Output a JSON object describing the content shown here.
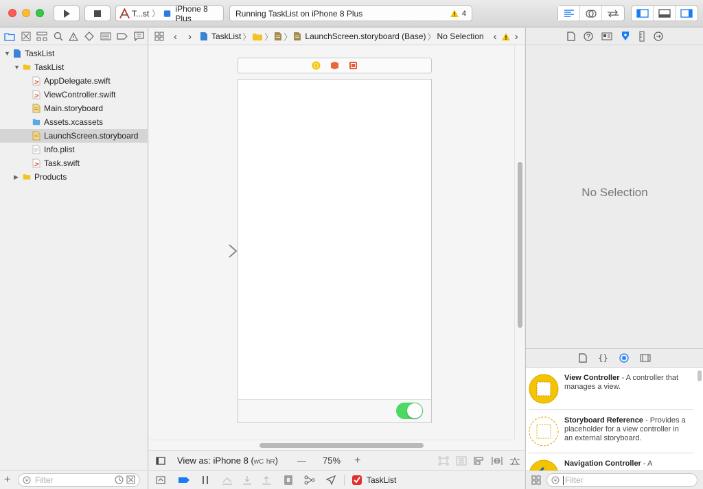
{
  "toolbar": {
    "scheme_name": "T...st",
    "device": "iPhone 8 Plus",
    "status_text": "Running TaskList on iPhone 8 Plus",
    "warning_count": "4"
  },
  "navigator": {
    "items": [
      {
        "label": "TaskList",
        "indent": 0,
        "kind": "project",
        "expanded": true
      },
      {
        "label": "TaskList",
        "indent": 1,
        "kind": "folder",
        "expanded": true
      },
      {
        "label": "AppDelegate.swift",
        "indent": 2,
        "kind": "swift"
      },
      {
        "label": "ViewController.swift",
        "indent": 2,
        "kind": "swift"
      },
      {
        "label": "Main.storyboard",
        "indent": 2,
        "kind": "storyboard"
      },
      {
        "label": "Assets.xcassets",
        "indent": 2,
        "kind": "assets"
      },
      {
        "label": "LaunchScreen.storyboard",
        "indent": 2,
        "kind": "storyboard",
        "selected": true
      },
      {
        "label": "Info.plist",
        "indent": 2,
        "kind": "plist"
      },
      {
        "label": "Task.swift",
        "indent": 2,
        "kind": "swift"
      },
      {
        "label": "Products",
        "indent": 1,
        "kind": "folder",
        "expanded": false
      }
    ],
    "filter_placeholder": "Filter"
  },
  "jumpbar": {
    "project": "TaskList",
    "file": "LaunchScreen.storyboard (Base)",
    "selection": "No Selection"
  },
  "editor": {
    "view_as_label": "View as: iPhone 8 (",
    "size_class_w": "wC",
    "size_class_h": "hR",
    "view_as_close": ")",
    "zoom_minus": "—",
    "zoom_level": "75%",
    "zoom_plus": "+",
    "toggle_on": true
  },
  "debug": {
    "target": "TaskList"
  },
  "inspector": {
    "empty_text": "No Selection",
    "library": [
      {
        "title": "View Controller",
        "desc": " - A controller that manages a view."
      },
      {
        "title": "Storyboard Reference",
        "desc": " - Provides a placeholder for a view controller in an external storyboard."
      },
      {
        "title": "Navigation Controller",
        "desc": " - A"
      }
    ],
    "filter_placeholder": "Filter"
  },
  "colors": {
    "accent": "#1a7cf5",
    "toggle_green": "#4cd964",
    "warning": "#f5c400",
    "folder": "#f3c322"
  }
}
